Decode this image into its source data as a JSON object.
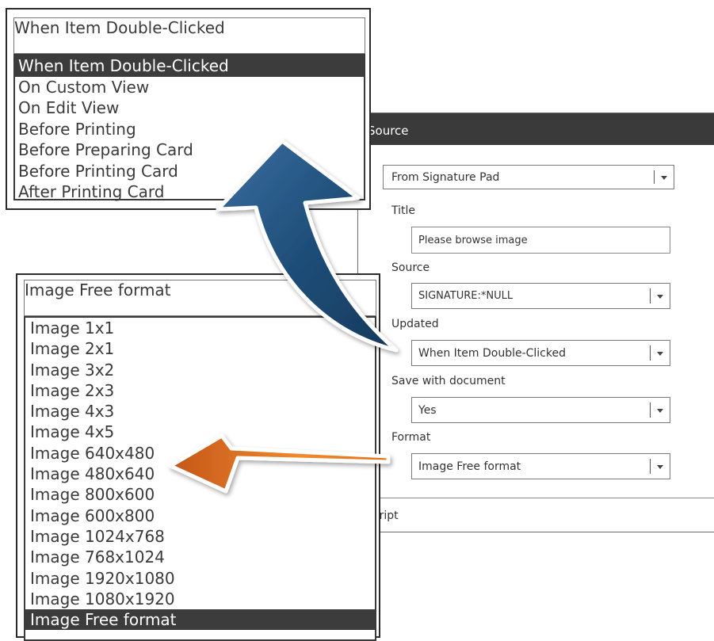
{
  "updated_dropdown": {
    "selected": "When Item Double-Clicked",
    "options": [
      "When Item Double-Clicked",
      "On Custom View",
      "On Edit View",
      "Before Printing",
      "Before Preparing Card",
      "Before Printing Card",
      "After Printing Card"
    ],
    "highlighted_index": 0
  },
  "format_dropdown": {
    "selected": "Image Free format",
    "options": [
      "Image 1x1",
      "Image 2x1",
      "Image 3x2",
      "Image 2x3",
      "Image 4x3",
      "Image 4x5",
      "Image 640x480",
      "Image 480x640",
      "Image 800x600",
      "Image 600x800",
      "Image 1024x768",
      "Image 768x1024",
      "Image 1920x1080",
      "Image 1080x1920",
      "Image Free format"
    ],
    "highlighted_index": 14
  },
  "panel": {
    "title": "Source",
    "source_type": "From Signature Pad",
    "title_label": "Title",
    "title_value": "Please browse image",
    "source_label": "Source",
    "source_value": "SIGNATURE:*NULL",
    "updated_label": "Updated",
    "updated_value": "When Item Double-Clicked",
    "save_label": "Save with document",
    "save_value": "Yes",
    "format_label": "Format",
    "format_value": "Image Free format",
    "script_label": "Script"
  },
  "colors": {
    "blue_arrow": "#1f4e79",
    "orange_arrow": "#e8731e",
    "header_dark": "#3a3a3a"
  }
}
